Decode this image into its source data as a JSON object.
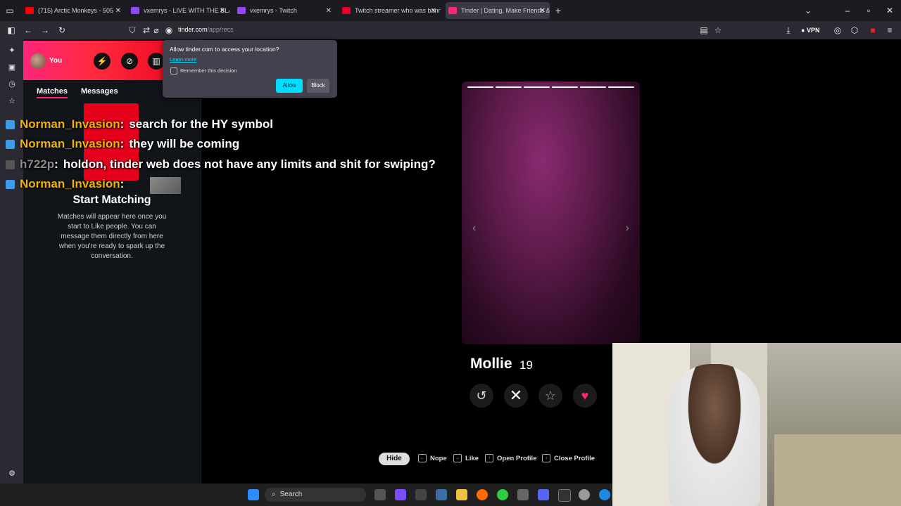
{
  "browser": {
    "tabs": [
      {
        "label": "(715) Arctic Monkeys - 505",
        "color": "#ff0000"
      },
      {
        "label": "vxemrys - LIVE WITH THE BLAC",
        "color": "#9146ff"
      },
      {
        "label": "vxemrys - Twitch",
        "color": "#9146ff"
      },
      {
        "label": "Twitch streamer who was bann",
        "color": "#e4002b"
      },
      {
        "label": "Tinder | Dating, Make Friends &",
        "color": "#fd267a"
      }
    ],
    "url_domain": "tinder.com",
    "url_path": "/app/recs",
    "vpn_label": "VPN"
  },
  "permission": {
    "question": "Allow tinder.com to access your location?",
    "learn_more": "Learn more",
    "remember": "Remember this decision",
    "allow": "Allow",
    "block": "Block"
  },
  "tinder": {
    "user_label": "You",
    "tabs": [
      "Matches",
      "Messages"
    ],
    "start_title": "Start Matching",
    "start_desc": "Matches will appear here once you start to Like people. You can message them directly from here when you're ready to spark up the conversation.",
    "profile": {
      "name": "Mollie",
      "age": "19"
    },
    "photo_count": 6,
    "shortcuts": {
      "hide": "Hide",
      "nope": "Nope",
      "like": "Like",
      "open": "Open Profile",
      "close": "Close Profile"
    }
  },
  "chat": [
    {
      "user": "Norman_Invasion",
      "msg": "search for the HY symbol"
    },
    {
      "user": "Norman_Invasion",
      "msg": "they will be coming"
    },
    {
      "user": "h722p",
      "msg": "holdon, tinder web does not have any limits and shit for swiping?"
    },
    {
      "user": "Norman_Invasion",
      "msg": ""
    }
  ],
  "taskbar": {
    "search": "Search"
  },
  "colors": {
    "tinder_red": "#fd267a",
    "chat_username": "#f0b400",
    "allow_button": "#00ddff"
  }
}
